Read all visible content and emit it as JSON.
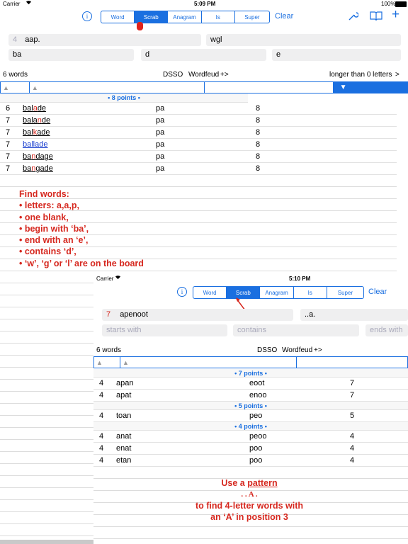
{
  "back": {
    "status": {
      "carrier": "Carrier",
      "time": "5:09 PM",
      "battery": "100%"
    },
    "tabs": [
      "Word",
      "Scrab",
      "Anagram",
      "Is",
      "Super"
    ],
    "active_tab": "Scrab",
    "clear": "Clear",
    "letters_count": "4",
    "letters": "aap.",
    "board_letters": "wgl",
    "starts_with": "ba",
    "contains": "d",
    "ends_with": "e",
    "word_count": "6 words",
    "dsso": "DSSO",
    "wordfeud": "Wordfeud",
    "plus": "+",
    "length_filter": "longer than 0 letters",
    "points_header": "• 8 points •",
    "rows": [
      {
        "len": "6",
        "word": "balade",
        "extra": "pa",
        "score": "8"
      },
      {
        "len": "7",
        "word": "balande",
        "extra": "pa",
        "score": "8"
      },
      {
        "len": "7",
        "word": "balkade",
        "extra": "pa",
        "score": "8"
      },
      {
        "len": "7",
        "word": "ballade",
        "extra": "pa",
        "score": "8"
      },
      {
        "len": "7",
        "word": "bandage",
        "extra": "pa",
        "score": "8"
      },
      {
        "len": "7",
        "word": "bangade",
        "extra": "pa",
        "score": "8"
      }
    ],
    "note_lines": [
      "Find words:",
      "• letters: a,a,p,",
      "• one blank,",
      "• begin with ‘ba’,",
      "• end with an ‘e’,",
      "• contains ‘d’,",
      "• ‘w’, ‘g’ or ‘l’ are on the board"
    ]
  },
  "front": {
    "status": {
      "carrier": "Carrier",
      "time": "5:10 PM"
    },
    "tabs": [
      "Word",
      "Scrab",
      "Anagram",
      "Is",
      "Super"
    ],
    "active_tab": "Scrab",
    "clear": "Clear",
    "letters_count": "7",
    "letters": "apenoot",
    "pattern": "..a.",
    "starts_placeholder": "starts with",
    "contains_placeholder": "contains",
    "ends_placeholder": "ends with",
    "word_count": "6 words",
    "dsso": "DSSO",
    "wordfeud": "Wordfeud",
    "plus": "+",
    "groups": [
      {
        "header": "• 7 points •",
        "rows": [
          {
            "len": "4",
            "word": "apan",
            "extra": "eoot",
            "score": "7"
          },
          {
            "len": "4",
            "word": "apat",
            "extra": "enoo",
            "score": "7"
          }
        ]
      },
      {
        "header": "• 5 points •",
        "rows": [
          {
            "len": "4",
            "word": "toan",
            "extra": "peo",
            "score": "5"
          }
        ]
      },
      {
        "header": "• 4 points •",
        "rows": [
          {
            "len": "4",
            "word": "anat",
            "extra": "peoo",
            "score": "4"
          },
          {
            "len": "4",
            "word": "enat",
            "extra": "poo",
            "score": "4"
          },
          {
            "len": "4",
            "word": "etan",
            "extra": "poo",
            "score": "4"
          }
        ]
      }
    ],
    "note": {
      "line1_a": "Use a ",
      "line1_b": "pattern",
      "line2": ". . A .",
      "line3": "to find 4-letter words with",
      "line4": "an ‘A’ in position 3"
    }
  },
  "colors": {
    "accent": "#1a6fe0",
    "note": "#d6281f"
  }
}
